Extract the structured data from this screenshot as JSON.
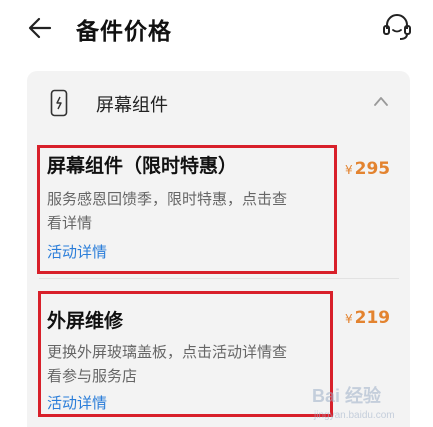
{
  "header": {
    "title": "备件价格",
    "back_icon": "arrow-left-icon",
    "support_icon": "headset-icon"
  },
  "section": {
    "title": "屏幕组件",
    "icon": "phone-icon",
    "toggle_icon": "chevron-up-icon",
    "items": [
      {
        "title": "屏幕组件（限时特惠）",
        "desc_line1": "服务感恩回馈季，限时特惠，点击查",
        "desc_line2": "看详情",
        "link": "活动详情",
        "currency": "¥",
        "price": "295"
      },
      {
        "title": "外屏维修",
        "desc_line1": "更换外屏玻璃盖板，点击活动详情查",
        "desc_line2": "看参与服务店",
        "link": "活动详情",
        "currency": "¥",
        "price": "219"
      }
    ]
  },
  "watermark": {
    "text": "Bai 经验",
    "sub": "jingyan.baidu.com"
  },
  "colors": {
    "price": "#e3832f",
    "link": "#2a7dd9",
    "highlight": "#d8202a",
    "card_bg": "#f3f3f3"
  }
}
